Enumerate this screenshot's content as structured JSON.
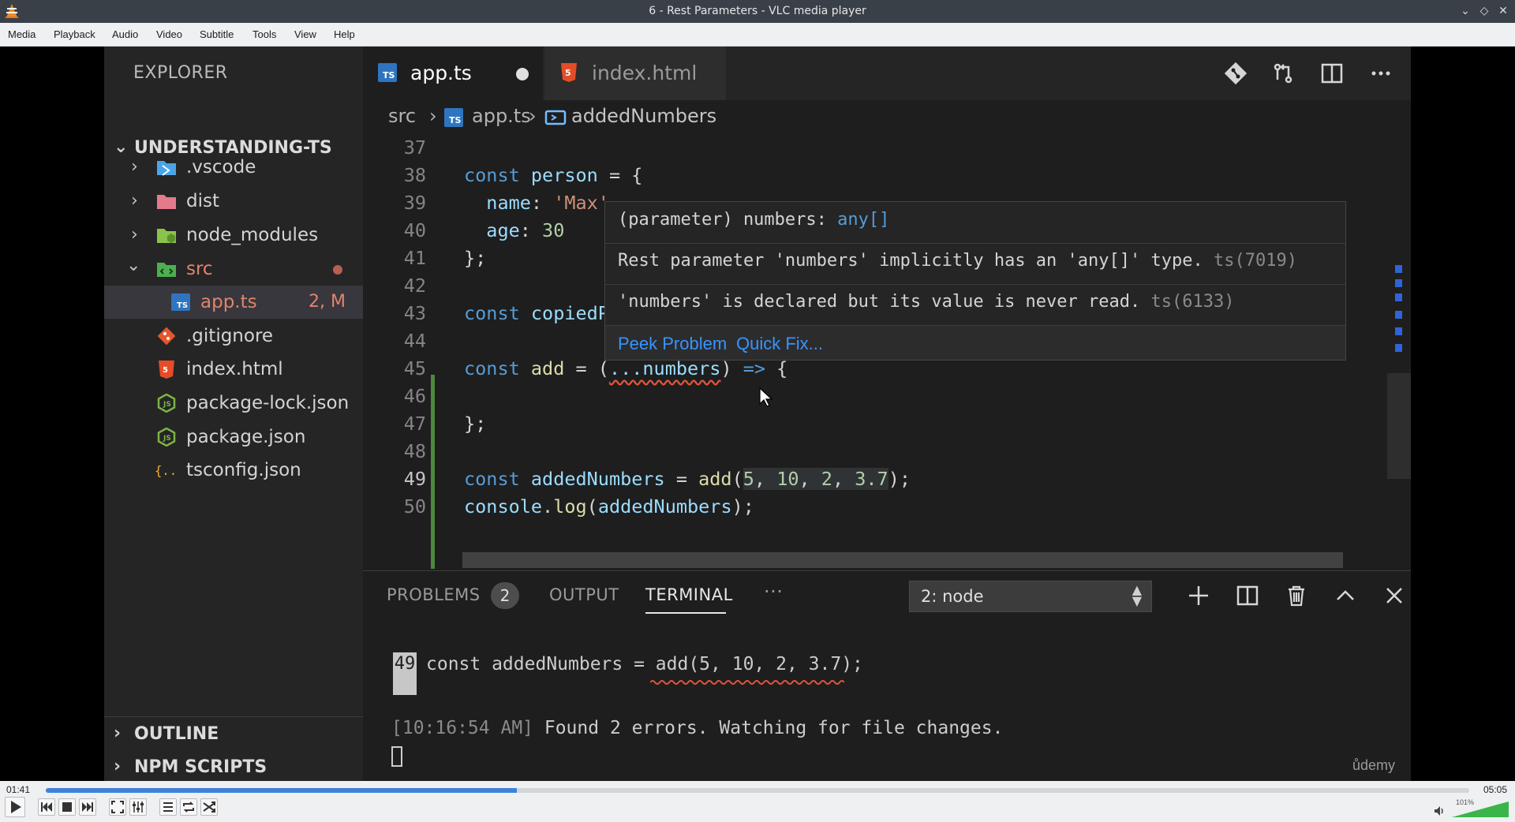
{
  "window": {
    "title": "6 - Rest Parameters - VLC media player"
  },
  "menu": [
    "Media",
    "Playback",
    "Audio",
    "Video",
    "Subtitle",
    "Tools",
    "View",
    "Help"
  ],
  "vscode": {
    "explorer_title": "EXPLORER",
    "project": "UNDERSTANDING-TS",
    "tree": [
      {
        "name": ".vscode",
        "icon": "vscode-folder-icon",
        "color": "#4aa5e8"
      },
      {
        "name": "dist",
        "icon": "dist-folder-icon",
        "color": "#e47b8a"
      },
      {
        "name": "node_modules",
        "icon": "node-folder-icon",
        "color": "#8bc34a"
      },
      {
        "name": "src",
        "icon": "src-folder-icon",
        "color": "#4caf50"
      },
      {
        "name": "app.ts",
        "icon": "typescript-file-icon",
        "badge": "2, M"
      },
      {
        "name": ".gitignore",
        "icon": "git-file-icon"
      },
      {
        "name": "index.html",
        "icon": "html-file-icon"
      },
      {
        "name": "package-lock.json",
        "icon": "node-json-icon"
      },
      {
        "name": "package.json",
        "icon": "node-json-icon"
      },
      {
        "name": "tsconfig.json",
        "icon": "json-braces-icon"
      }
    ],
    "outline": "OUTLINE",
    "npm_scripts": "NPM SCRIPTS",
    "tabs": [
      {
        "label": "app.ts",
        "icon": "typescript-file-icon"
      },
      {
        "label": "index.html",
        "icon": "html-file-icon"
      }
    ],
    "breadcrumbs": {
      "folder": "src",
      "file": "app.ts",
      "symbol": "addedNumbers"
    },
    "lines": {
      "n37": "37",
      "n38": "38",
      "n39": "39",
      "n40": "40",
      "n41": "41",
      "n42": "42",
      "n43": "43",
      "n44": "44",
      "n45": "45",
      "n46": "46",
      "n47": "47",
      "n48": "48",
      "n49": "49",
      "n50": "50"
    },
    "code": {
      "l38_kw": "const",
      "l38_var": "person",
      "l38_rest": " = {",
      "l39_key": "name",
      "l39_str": "'Max'",
      "l40_key": "age",
      "l40_num": "30",
      "l41": "};",
      "l43_kw": "const",
      "l43_var": "copiedP",
      "l45_kw": "const",
      "l45_fn": "add",
      "l45_pre": " = (",
      "l45_param": "...numbers",
      "l45_post": ") ",
      "l45_arrow": "=>",
      "l45_brace": " {",
      "l47": "};",
      "l49_kw": "const",
      "l49_var": "addedNumbers",
      "l49_eq": " = ",
      "l49_fn": "add",
      "l49_open": "(",
      "l49_a": "5",
      "l49_b": "10",
      "l49_c": "2",
      "l49_d": "3.7",
      "l49_close": ");",
      "l50_obj": "console",
      "l50_fn": "log",
      "l50_open": "(",
      "l50_arg": "addedNumbers",
      "l50_close": ");"
    },
    "hover": {
      "sig_pre": "(parameter) numbers: ",
      "sig_type": "any[]",
      "msg1": "Rest parameter 'numbers' implicitly has an 'any[]' type.",
      "code1": "ts(7019)",
      "msg2": "'numbers' is declared but its value is never read.",
      "code2": "ts(6133)",
      "peek": "Peek Problem",
      "quickfix": "Quick Fix..."
    },
    "panel": {
      "problems": "PROBLEMS",
      "problems_count": "2",
      "output": "OUTPUT",
      "terminal": "TERMINAL",
      "more": "···",
      "terminal_select": "2: node",
      "term_line_no": "49",
      "term_code": "const addedNumbers = add(5, 10, 2, 3.7);",
      "term_time": "[10:16:54 AM]",
      "term_msg": " Found 2 errors. Watching for file changes.",
      "watermark": "ůdemy"
    }
  },
  "player": {
    "elapsed": "01:41",
    "duration": "05:05",
    "progress": 0.331,
    "volume_label": "101%",
    "volume": 1.01,
    "accent": "#3d82d9"
  }
}
